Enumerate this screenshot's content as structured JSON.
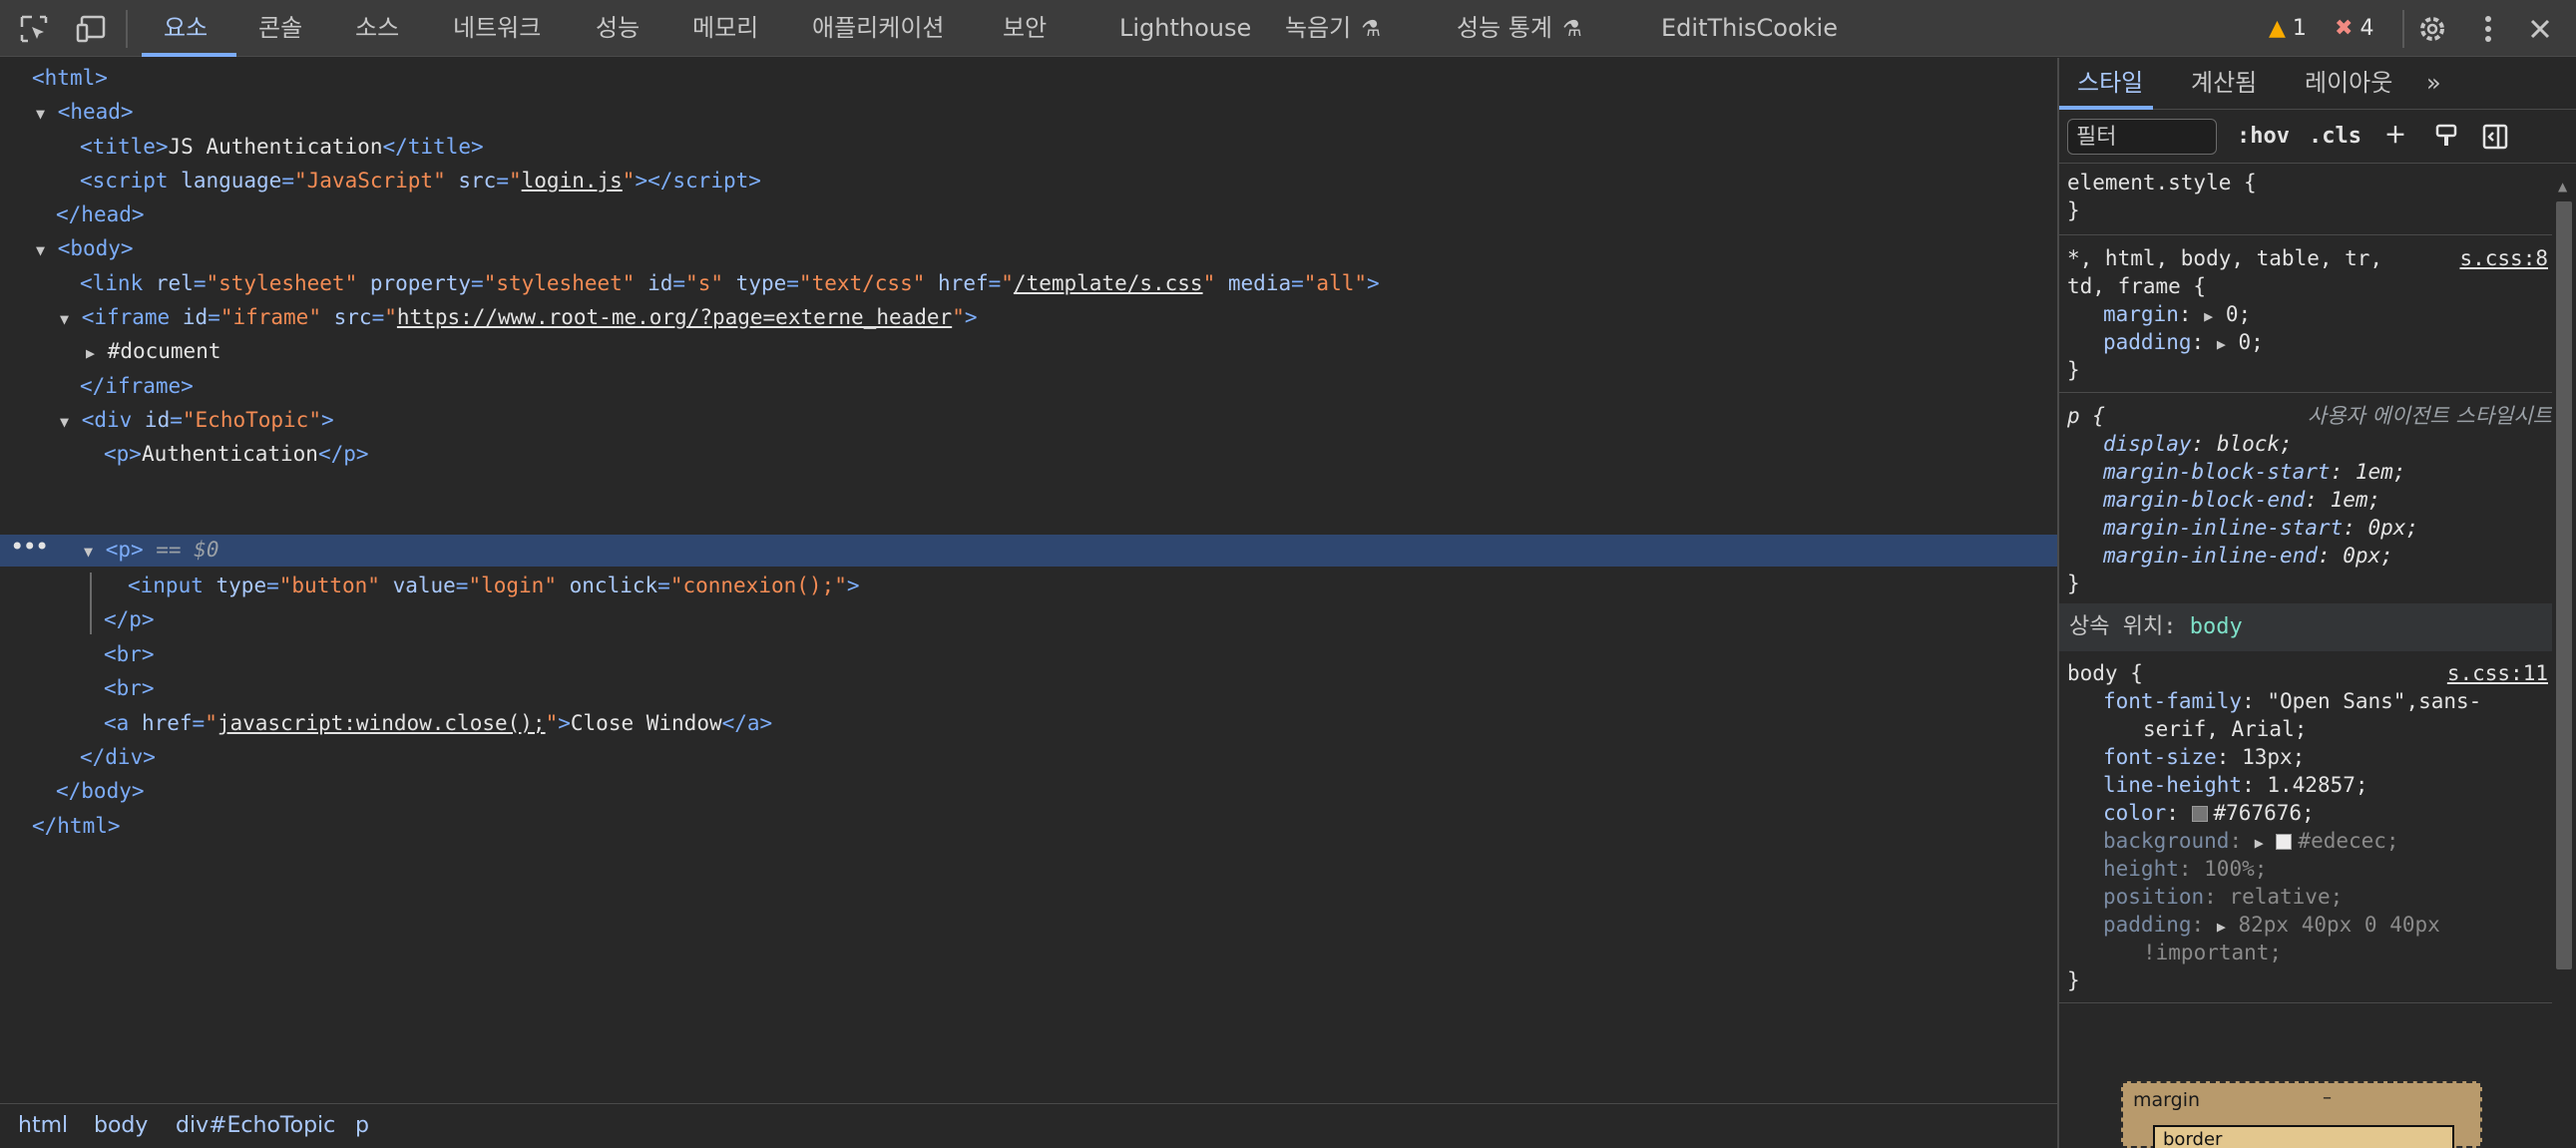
{
  "toolbar": {
    "tabs": [
      "요소",
      "콘솔",
      "소스",
      "네트워크",
      "성능",
      "메모리",
      "애플리케이션",
      "보안",
      "Lighthouse",
      "녹음기",
      "성능 통계",
      "EditThisCookie"
    ],
    "active_tab": "요소",
    "warnings": "1",
    "errors": "4",
    "icons": [
      "inspect-icon",
      "device-icon",
      "flask-icon",
      "warning-icon",
      "error-icon",
      "gear-icon",
      "more-icon",
      "close-icon"
    ]
  },
  "dom": {
    "html_open": "html",
    "head_open": "head",
    "title_tag": "title",
    "title_text": "JS Authentication",
    "script_tag": "script",
    "script_language": "JavaScript",
    "script_src": "login.js",
    "head_close": "head",
    "body_open": "body",
    "link_rel": "stylesheet",
    "link_property": "stylesheet",
    "link_id": "s",
    "link_type": "text/css",
    "link_href": "/template/s.css",
    "link_media": "all",
    "iframe_id": "iframe",
    "iframe_src": "https://www.root-me.org/?page=externe_header",
    "document_node": "#document",
    "iframe_close": "iframe",
    "div_id": "EchoTopic",
    "p_text": "Authentication",
    "selected_ref": "== $0",
    "input_type": "button",
    "input_value": "login",
    "input_onclick": "connexion();",
    "a_href": "javascript:window.close();",
    "a_text": "Close Window"
  },
  "breadcrumb": [
    "html",
    "body",
    "div#EchoTopic",
    "p"
  ],
  "sidebar": {
    "tabs": [
      "스타일",
      "계산됨",
      "레이아웃"
    ],
    "active_tab": "스타일",
    "filter_placeholder": "필터",
    "hov": ":hov",
    "cls": ".cls",
    "element_style": "element.style {",
    "universal_selector": "*, html, body, table, tr,",
    "universal_selector_2": "td, frame {",
    "universal_source": "s.css:8",
    "margin": "0;",
    "padding": "0;",
    "p_selector": "p {",
    "ua_note": "사용자 에이전트 스타일시트",
    "ua_display": "block;",
    "ua_mbs": "1em;",
    "ua_mbe": "1em;",
    "ua_mis": "0px;",
    "ua_mie": "0px;",
    "inherited_label": "상속 위치:",
    "inherited_from": "body",
    "body_selector": "body {",
    "body_source": "s.css:11",
    "font_family": "\"Open Sans\",sans-",
    "font_family_2": "serif, Arial;",
    "font_size": "13px;",
    "line_height": "1.42857;",
    "color": "#767676;",
    "color_hex": "#767676",
    "background": "#edecec;",
    "background_hex": "#edecec",
    "height": "100%;",
    "position": "relative;",
    "padding_body": "82px 40px 0 40px",
    "important": "!important;",
    "boxmodel_margin": "margin",
    "boxmodel_border": "border",
    "boxmodel_dash": "–"
  }
}
